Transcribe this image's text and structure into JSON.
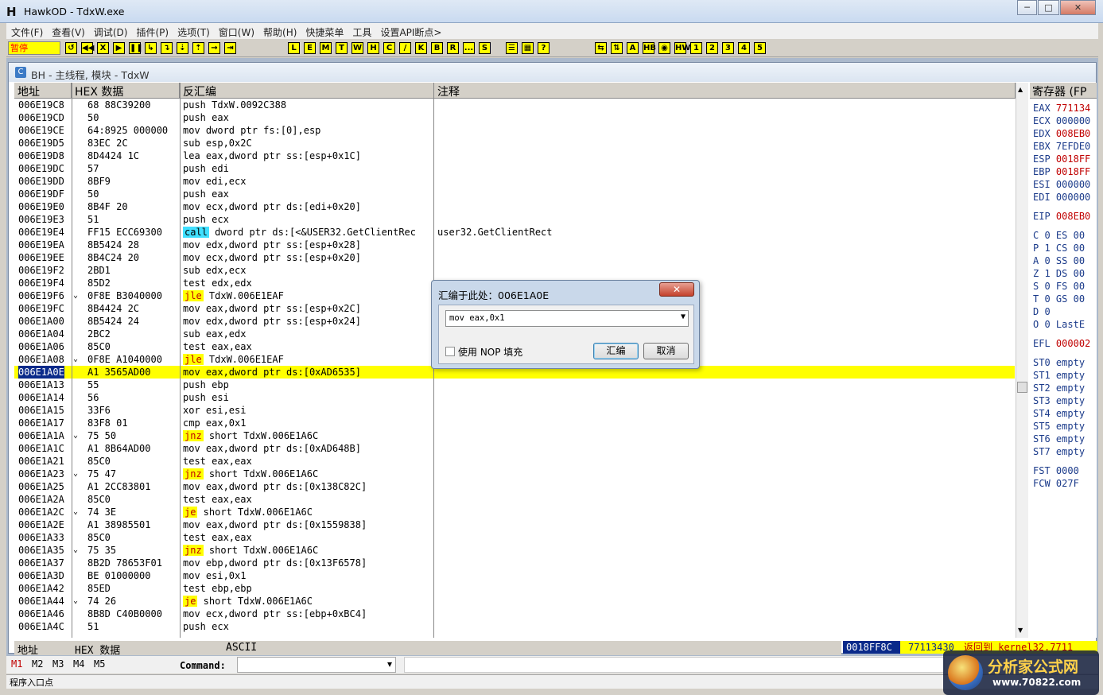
{
  "window": {
    "app_icon": "H",
    "title": "HawkOD - TdxW.exe",
    "min": "─",
    "max": "□",
    "close": "✕"
  },
  "menu": [
    "文件(F)",
    "查看(V)",
    "调试(D)",
    "插件(P)",
    "选项(T)",
    "窗口(W)",
    "帮助(H)",
    "快捷菜单",
    "工具",
    "设置API断点>"
  ],
  "toolbar": {
    "status": "暂停",
    "buttons_a": [
      "↺",
      "◀◀",
      "X",
      "▶",
      "❚❚",
      "↳",
      "↴",
      "⇣",
      "⇡",
      "→",
      "⇥"
    ],
    "buttons_b": [
      "L",
      "E",
      "M",
      "T",
      "W",
      "H",
      "C",
      "/",
      "K",
      "B",
      "R",
      "...",
      "S"
    ],
    "buttons_c": [
      "☰",
      "▦",
      "?"
    ],
    "buttons_d": [
      "⇆",
      "⇅",
      "A",
      "HB",
      "◉",
      "HW",
      "1",
      "2",
      "3",
      "4",
      "5"
    ]
  },
  "child": {
    "icon": "C",
    "title": "BH - 主线程, 模块 - TdxW"
  },
  "columns": {
    "addr": "地址",
    "hex": "HEX 数据",
    "disasm": "反汇编",
    "comment": "注释"
  },
  "rows": [
    {
      "addr": "006E19C8",
      "arrow": "",
      "hex": "68 88C39200",
      "mn": "",
      "rest": "push TdxW.0092C388",
      "comment": ""
    },
    {
      "addr": "006E19CD",
      "arrow": "",
      "hex": "50",
      "mn": "",
      "rest": "push eax",
      "comment": ""
    },
    {
      "addr": "006E19CE",
      "arrow": "",
      "hex": "64:8925 000000",
      "mn": "",
      "rest": "mov dword ptr fs:[0],esp",
      "comment": ""
    },
    {
      "addr": "006E19D5",
      "arrow": "",
      "hex": "83EC 2C",
      "mn": "",
      "rest": "sub esp,0x2C",
      "comment": ""
    },
    {
      "addr": "006E19D8",
      "arrow": "",
      "hex": "8D4424 1C",
      "mn": "",
      "rest": "lea eax,dword ptr ss:[esp+0x1C]",
      "comment": ""
    },
    {
      "addr": "006E19DC",
      "arrow": "",
      "hex": "57",
      "mn": "",
      "rest": "push edi",
      "comment": ""
    },
    {
      "addr": "006E19DD",
      "arrow": "",
      "hex": "8BF9",
      "mn": "",
      "rest": "mov edi,ecx",
      "comment": ""
    },
    {
      "addr": "006E19DF",
      "arrow": "",
      "hex": "50",
      "mn": "",
      "rest": "push eax",
      "comment": ""
    },
    {
      "addr": "006E19E0",
      "arrow": "",
      "hex": "8B4F 20",
      "mn": "",
      "rest": "mov ecx,dword ptr ds:[edi+0x20]",
      "comment": ""
    },
    {
      "addr": "006E19E3",
      "arrow": "",
      "hex": "51",
      "mn": "",
      "rest": "push ecx",
      "comment": ""
    },
    {
      "addr": "006E19E4",
      "arrow": "",
      "hex": "FF15 ECC69300",
      "mn": "call",
      "rest": " dword ptr ds:[<&USER32.GetClientRec",
      "comment": "user32.GetClientRect"
    },
    {
      "addr": "006E19EA",
      "arrow": "",
      "hex": "8B5424 28",
      "mn": "",
      "rest": "mov edx,dword ptr ss:[esp+0x28]",
      "comment": ""
    },
    {
      "addr": "006E19EE",
      "arrow": "",
      "hex": "8B4C24 20",
      "mn": "",
      "rest": "mov ecx,dword ptr ss:[esp+0x20]",
      "comment": ""
    },
    {
      "addr": "006E19F2",
      "arrow": "",
      "hex": "2BD1",
      "mn": "",
      "rest": "sub edx,ecx",
      "comment": ""
    },
    {
      "addr": "006E19F4",
      "arrow": "",
      "hex": "85D2",
      "mn": "",
      "rest": "test edx,edx",
      "comment": ""
    },
    {
      "addr": "006E19F6",
      "arrow": "⌄",
      "hex": "0F8E B3040000",
      "mn": "jle",
      "rest": " TdxW.006E1EAF",
      "comment": ""
    },
    {
      "addr": "006E19FC",
      "arrow": "",
      "hex": "8B4424 2C",
      "mn": "",
      "rest": "mov eax,dword ptr ss:[esp+0x2C]",
      "comment": ""
    },
    {
      "addr": "006E1A00",
      "arrow": "",
      "hex": "8B5424 24",
      "mn": "",
      "rest": "mov edx,dword ptr ss:[esp+0x24]",
      "comment": ""
    },
    {
      "addr": "006E1A04",
      "arrow": "",
      "hex": "2BC2",
      "mn": "",
      "rest": "sub eax,edx",
      "comment": ""
    },
    {
      "addr": "006E1A06",
      "arrow": "",
      "hex": "85C0",
      "mn": "",
      "rest": "test eax,eax",
      "comment": ""
    },
    {
      "addr": "006E1A08",
      "arrow": "⌄",
      "hex": "0F8E A1040000",
      "mn": "jle",
      "rest": " TdxW.006E1EAF",
      "comment": ""
    },
    {
      "addr": "006E1A0E",
      "arrow": "",
      "hex": "A1 3565AD00",
      "mn": "",
      "rest": "mov eax,dword ptr ds:[0xAD6535]",
      "comment": "",
      "sel": true
    },
    {
      "addr": "006E1A13",
      "arrow": "",
      "hex": "55",
      "mn": "",
      "rest": "push ebp",
      "comment": ""
    },
    {
      "addr": "006E1A14",
      "arrow": "",
      "hex": "56",
      "mn": "",
      "rest": "push esi",
      "comment": ""
    },
    {
      "addr": "006E1A15",
      "arrow": "",
      "hex": "33F6",
      "mn": "",
      "rest": "xor esi,esi",
      "comment": ""
    },
    {
      "addr": "006E1A17",
      "arrow": "",
      "hex": "83F8 01",
      "mn": "",
      "rest": "cmp eax,0x1",
      "comment": ""
    },
    {
      "addr": "006E1A1A",
      "arrow": "⌄",
      "hex": "75 50",
      "mn": "jnz",
      "rest": " short TdxW.006E1A6C",
      "comment": ""
    },
    {
      "addr": "006E1A1C",
      "arrow": "",
      "hex": "A1 8B64AD00",
      "mn": "",
      "rest": "mov eax,dword ptr ds:[0xAD648B]",
      "comment": ""
    },
    {
      "addr": "006E1A21",
      "arrow": "",
      "hex": "85C0",
      "mn": "",
      "rest": "test eax,eax",
      "comment": ""
    },
    {
      "addr": "006E1A23",
      "arrow": "⌄",
      "hex": "75 47",
      "mn": "jnz",
      "rest": " short TdxW.006E1A6C",
      "comment": ""
    },
    {
      "addr": "006E1A25",
      "arrow": "",
      "hex": "A1 2CC83801",
      "mn": "",
      "rest": "mov eax,dword ptr ds:[0x138C82C]",
      "comment": ""
    },
    {
      "addr": "006E1A2A",
      "arrow": "",
      "hex": "85C0",
      "mn": "",
      "rest": "test eax,eax",
      "comment": ""
    },
    {
      "addr": "006E1A2C",
      "arrow": "⌄",
      "hex": "74 3E",
      "mn": "je",
      "rest": " short TdxW.006E1A6C",
      "comment": ""
    },
    {
      "addr": "006E1A2E",
      "arrow": "",
      "hex": "A1 38985501",
      "mn": "",
      "rest": "mov eax,dword ptr ds:[0x1559838]",
      "comment": ""
    },
    {
      "addr": "006E1A33",
      "arrow": "",
      "hex": "85C0",
      "mn": "",
      "rest": "test eax,eax",
      "comment": ""
    },
    {
      "addr": "006E1A35",
      "arrow": "⌄",
      "hex": "75 35",
      "mn": "jnz",
      "rest": " short TdxW.006E1A6C",
      "comment": ""
    },
    {
      "addr": "006E1A37",
      "arrow": "",
      "hex": "8B2D 78653F01",
      "mn": "",
      "rest": "mov ebp,dword ptr ds:[0x13F6578]",
      "comment": ""
    },
    {
      "addr": "006E1A3D",
      "arrow": "",
      "hex": "BE 01000000",
      "mn": "",
      "rest": "mov esi,0x1",
      "comment": ""
    },
    {
      "addr": "006E1A42",
      "arrow": "",
      "hex": "85ED",
      "mn": "",
      "rest": "test ebp,ebp",
      "comment": ""
    },
    {
      "addr": "006E1A44",
      "arrow": "⌄",
      "hex": "74 26",
      "mn": "je",
      "rest": " short TdxW.006E1A6C",
      "comment": ""
    },
    {
      "addr": "006E1A46",
      "arrow": "",
      "hex": "8B8D C40B0000",
      "mn": "",
      "rest": "mov ecx,dword ptr ss:[ebp+0xBC4]",
      "comment": ""
    },
    {
      "addr": "006E1A4C",
      "arrow": "",
      "hex": "51",
      "mn": "",
      "rest": "push ecx",
      "comment": ""
    }
  ],
  "registers": {
    "header": "寄存器 (FP",
    "items": [
      {
        "n": "EAX",
        "v": "771134",
        "red": true
      },
      {
        "n": "ECX",
        "v": "000000",
        "red": false
      },
      {
        "n": "EDX",
        "v": "008EB0",
        "red": true
      },
      {
        "n": "EBX",
        "v": "7EFDE0",
        "red": false
      },
      {
        "n": "ESP",
        "v": "0018FF",
        "red": true
      },
      {
        "n": "EBP",
        "v": "0018FF",
        "red": true
      },
      {
        "n": "ESI",
        "v": "000000",
        "red": false
      },
      {
        "n": "EDI",
        "v": "000000",
        "red": false
      },
      {
        "n": "EIP",
        "v": "008EB0",
        "red": true,
        "gap": true
      },
      {
        "n": "C 0",
        "v": "ES 00",
        "red": false,
        "gap": true
      },
      {
        "n": "P 1",
        "v": "CS 00",
        "red": false
      },
      {
        "n": "A 0",
        "v": "SS 00",
        "red": false
      },
      {
        "n": "Z 1",
        "v": "DS 00",
        "red": false
      },
      {
        "n": "S 0",
        "v": "FS 00",
        "red": false
      },
      {
        "n": "T 0",
        "v": "GS 00",
        "red": false
      },
      {
        "n": "D 0",
        "v": "",
        "red": false
      },
      {
        "n": "O 0",
        "v": "LastE",
        "red": false
      },
      {
        "n": "EFL",
        "v": "000002",
        "red": true,
        "gap": true
      },
      {
        "n": "ST0",
        "v": "empty",
        "red": false,
        "gap": true
      },
      {
        "n": "ST1",
        "v": "empty",
        "red": false
      },
      {
        "n": "ST2",
        "v": "empty",
        "red": false
      },
      {
        "n": "ST3",
        "v": "empty",
        "red": false
      },
      {
        "n": "ST4",
        "v": "empty",
        "red": false
      },
      {
        "n": "ST5",
        "v": "empty",
        "red": false
      },
      {
        "n": "ST6",
        "v": "empty",
        "red": false
      },
      {
        "n": "ST7",
        "v": "empty",
        "red": false
      },
      {
        "n": "FST",
        "v": "0000",
        "red": false,
        "gap": true
      },
      {
        "n": "FCW",
        "v": "027F",
        "red": false
      }
    ]
  },
  "dump_header": {
    "addr": "地址",
    "hex": "HEX 数据",
    "ascii": "ASCII"
  },
  "stack_header": {
    "addr": "0018FF8C",
    "val": "77113430",
    "comment": "返回到 kernel32.7711"
  },
  "command": {
    "marks": [
      "M1",
      "M2",
      "M3",
      "M4",
      "M5"
    ],
    "label": "Command:",
    "value": "",
    "dropdown": "▾"
  },
  "status_text": "程序入口点",
  "dialog": {
    "title": "汇编于此处：006E1A0E",
    "close": "✕",
    "input": "mov eax,0x1",
    "use_nop": "使用 NOP 填充",
    "assemble": "汇编",
    "cancel": "取消"
  },
  "watermark": {
    "line1": "分析家公式网",
    "line2": "www.70822.com"
  }
}
